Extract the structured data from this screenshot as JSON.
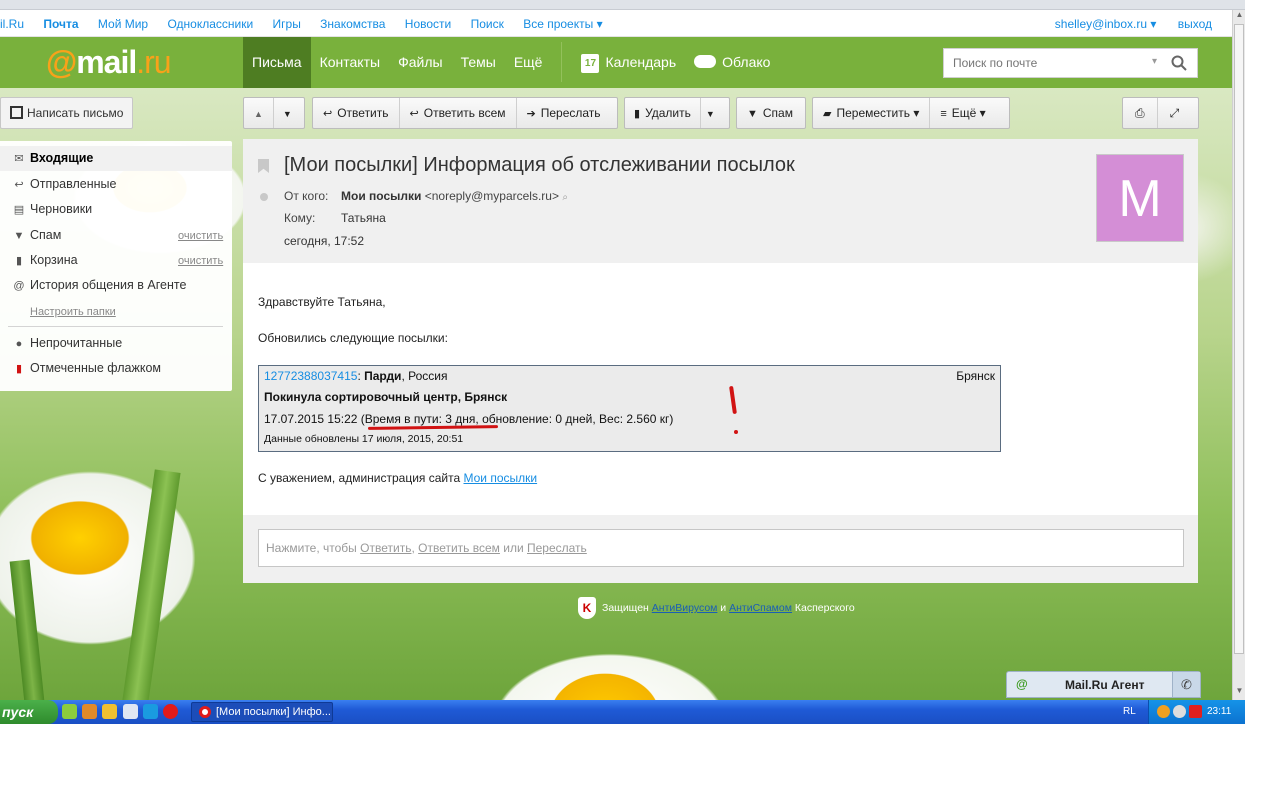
{
  "portal": {
    "links": [
      "il.Ru",
      "Почта",
      "Мой Мир",
      "Одноклассники",
      "Игры",
      "Знакомства",
      "Новости",
      "Поиск",
      "Все проекты ▾"
    ],
    "user": "shelley@inbox.ru ▾",
    "logout": "выход"
  },
  "header": {
    "logo_at": "@",
    "logo_mail": "mail",
    "logo_ru": ".ru",
    "nav": [
      "Письма",
      "Контакты",
      "Файлы",
      "Темы",
      "Ещё"
    ],
    "calendar_day": "17",
    "calendar": "Календарь",
    "cloud": "Облако",
    "search_placeholder": "Поиск по почте",
    "accent_color": "#79b13c"
  },
  "sidebar": {
    "compose": "Написать письмо",
    "folders": [
      {
        "label": "Входящие",
        "icon": "envelope-icon"
      },
      {
        "label": "Отправленные",
        "icon": "reply-icon"
      },
      {
        "label": "Черновики",
        "icon": "draft-icon"
      },
      {
        "label": "Спам",
        "icon": "thumb-down-icon"
      },
      {
        "label": "Корзина",
        "icon": "trash-icon"
      },
      {
        "label": "История общения в Агенте",
        "icon": "at-icon"
      }
    ],
    "clean_label": "очистить",
    "setup_folders": "Настроить папки",
    "filters": [
      {
        "label": "Непрочитанные",
        "icon": "dot-icon"
      },
      {
        "label": "Отмеченные флажком",
        "icon": "flag-icon"
      }
    ]
  },
  "toolbar": {
    "reply": "Ответить",
    "reply_all": "Ответить всем",
    "forward": "Переслать",
    "delete": "Удалить",
    "spam": "Спам",
    "move": "Переместить ▾",
    "more": "Ещё ▾"
  },
  "message": {
    "subject": "[Мои посылки] Информация об отслеживании посылок",
    "from_label": "От кого:",
    "from_name": "Мои посылки",
    "from_email": "<noreply@myparcels.ru>",
    "to_label": "Кому:",
    "to_name": "Татьяна",
    "date": "сегодня, 17:52",
    "avatar_letter": "М",
    "greeting": "Здравствуйте Татьяна,",
    "intro": "Обновились следующие посылки:",
    "parcel": {
      "tracking": "12772388037415",
      "sender": "Парди",
      "country": ", Россия",
      "city": "Брянск",
      "status": "Покинула сортировочный центр, Брянск",
      "details": "17.07.2015 15:22 (Время в пути: 3 дня, обновление: 0 дней, Вес: 2.560 кг)",
      "updated": "Данные обновлены 17 июля, 2015, 20:51"
    },
    "signoff": "С уважением, администрация сайта ",
    "signoff_link": "Мои посылки"
  },
  "reply_hint": {
    "prefix": "Нажмите, чтобы ",
    "reply": "Ответить",
    "sep": ", ",
    "reply_all": "Ответить всем",
    "or": " или ",
    "forward": "Переслать"
  },
  "kaspersky": {
    "prefix": "Защищен ",
    "antivirus": "АнтиВирусом",
    "and": " и ",
    "antispam": "АнтиСпамом",
    "suffix": " Касперского"
  },
  "agent": {
    "label": "Mail.Ru Агент"
  },
  "taskbar": {
    "start": "пуск",
    "window": "[Мои посылки] Инфо...",
    "lang": "RL",
    "time": "23:11"
  }
}
